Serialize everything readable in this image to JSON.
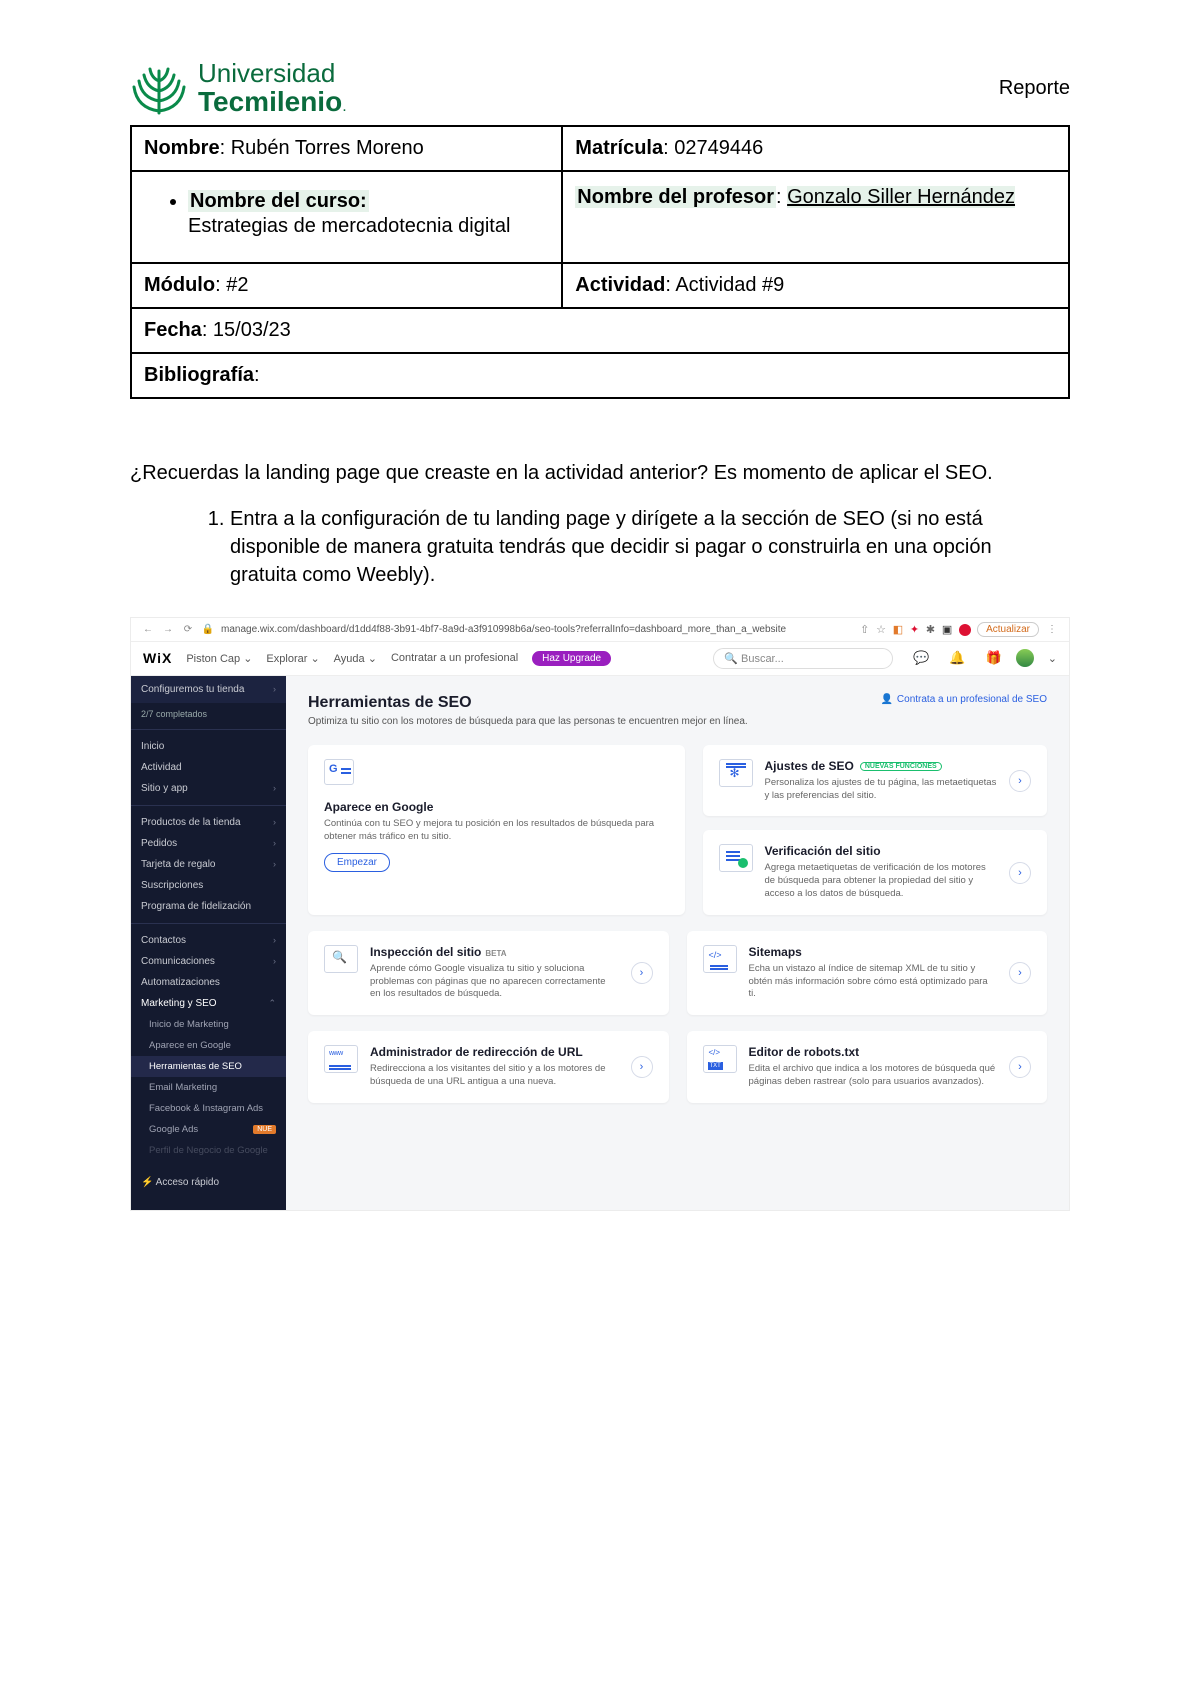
{
  "header": {
    "uni": "Universidad",
    "brand": "Tecmilenio",
    "dot": ".",
    "reporte": "Reporte"
  },
  "info": {
    "nombre_label": "Nombre",
    "nombre_value": ": Rubén Torres Moreno",
    "matricula_label": "Matrícula",
    "matricula_value": ": 02749446",
    "curso_label": "Nombre del curso:",
    "curso_value": "Estrategias de mercadotecnia digital",
    "profesor_label": "Nombre del profesor",
    "profesor_sep": ": ",
    "profesor_value": "Gonzalo Siller Hernández",
    "modulo_label": "Módulo",
    "modulo_value": ": #2",
    "actividad_label": "Actividad",
    "actividad_value": ": Actividad #9",
    "fecha_label": "Fecha",
    "fecha_value": ": 15/03/23",
    "biblio_label": "Bibliografía",
    "biblio_value": ":"
  },
  "body": {
    "intro": "¿Recuerdas la landing page que creaste en la actividad anterior? Es momento de aplicar el SEO.",
    "step1": "Entra a la configuración de tu landing page y dirígete a la sección de SEO (si no está disponible de manera gratuita tendrás que decidir si pagar o construirla en una opción gratuita como Weebly)."
  },
  "chrome": {
    "back": "←",
    "fwd": "→",
    "reload": "⟳",
    "lock": "🔒",
    "url": "manage.wix.com/dashboard/d1dd4f88-3b91-4bf7-8a9d-a3f910998b6a/seo-tools?referralInfo=dashboard_more_than_a_website",
    "share": "⇧",
    "star": "☆",
    "actualizar": "Actualizar",
    "menu": "⋮"
  },
  "wixtop": {
    "brand": "WiX",
    "site": "Piston Cap",
    "explorar": "Explorar",
    "ayuda": "Ayuda",
    "contratar": "Contratar a un profesional",
    "upgrade": "Haz Upgrade",
    "search_placeholder": "Buscar...",
    "search_icon": "🔍",
    "chat": "💬",
    "bell": "🔔",
    "gift": "🎁",
    "caret": "⌄"
  },
  "sidebar": {
    "config": "Configuremos tu tienda",
    "progress": "2/7 completados",
    "sec1": [
      "Inicio",
      "Actividad",
      "Sitio y app"
    ],
    "sec2": [
      "Productos de la tienda",
      "Pedidos",
      "Tarjeta de regalo",
      "Suscripciones",
      "Programa de fidelización"
    ],
    "sec3": [
      "Contactos",
      "Comunicaciones",
      "Automatizaciones",
      "Marketing y SEO"
    ],
    "sub": [
      "Inicio de Marketing",
      "Aparece en Google",
      "Herramientas de SEO",
      "Email Marketing",
      "Facebook & Instagram Ads",
      "Google Ads"
    ],
    "nue": "NUE",
    "acceso": "⚡ Acceso rápido"
  },
  "main": {
    "title": "Herramientas de SEO",
    "subtitle": "Optimiza tu sitio con los motores de búsqueda para que las personas te encuentren mejor en línea.",
    "hire_icon": "👤",
    "hire": "Contrata a un profesional de SEO"
  },
  "cards": {
    "google_title": "Aparece en Google",
    "google_desc": "Continúa con tu SEO y mejora tu posición en los resultados de búsqueda para obtener más tráfico en tu sitio.",
    "empezar": "Empezar",
    "ajustes_title": "Ajustes de SEO",
    "ajustes_badge": "NUEVAS FUNCIONES",
    "ajustes_desc": "Personaliza los ajustes de tu página, las metaetiquetas y las preferencias del sitio.",
    "verif_title": "Verificación del sitio",
    "verif_desc": "Agrega metaetiquetas de verificación de los motores de búsqueda para obtener la propiedad del sitio y acceso a los datos de búsqueda.",
    "inspec_title": "Inspección del sitio",
    "inspec_beta": "BETA",
    "inspec_desc": "Aprende cómo Google visualiza tu sitio y soluciona problemas con páginas que no aparecen correctamente en los resultados de búsqueda.",
    "sitemap_title": "Sitemaps",
    "sitemap_desc": "Echa un vistazo al índice de sitemap XML de tu sitio y obtén más información sobre cómo está optimizado para ti.",
    "redir_title": "Administrador de redirección de URL",
    "redir_desc": "Redirecciona a los visitantes del sitio y a los motores de búsqueda de una URL antigua a una nueva.",
    "robots_title": "Editor de robots.txt",
    "robots_desc": "Edita el archivo que indica a los motores de búsqueda qué páginas deben rastrear (solo para usuarios avanzados).",
    "arrow": "›"
  }
}
